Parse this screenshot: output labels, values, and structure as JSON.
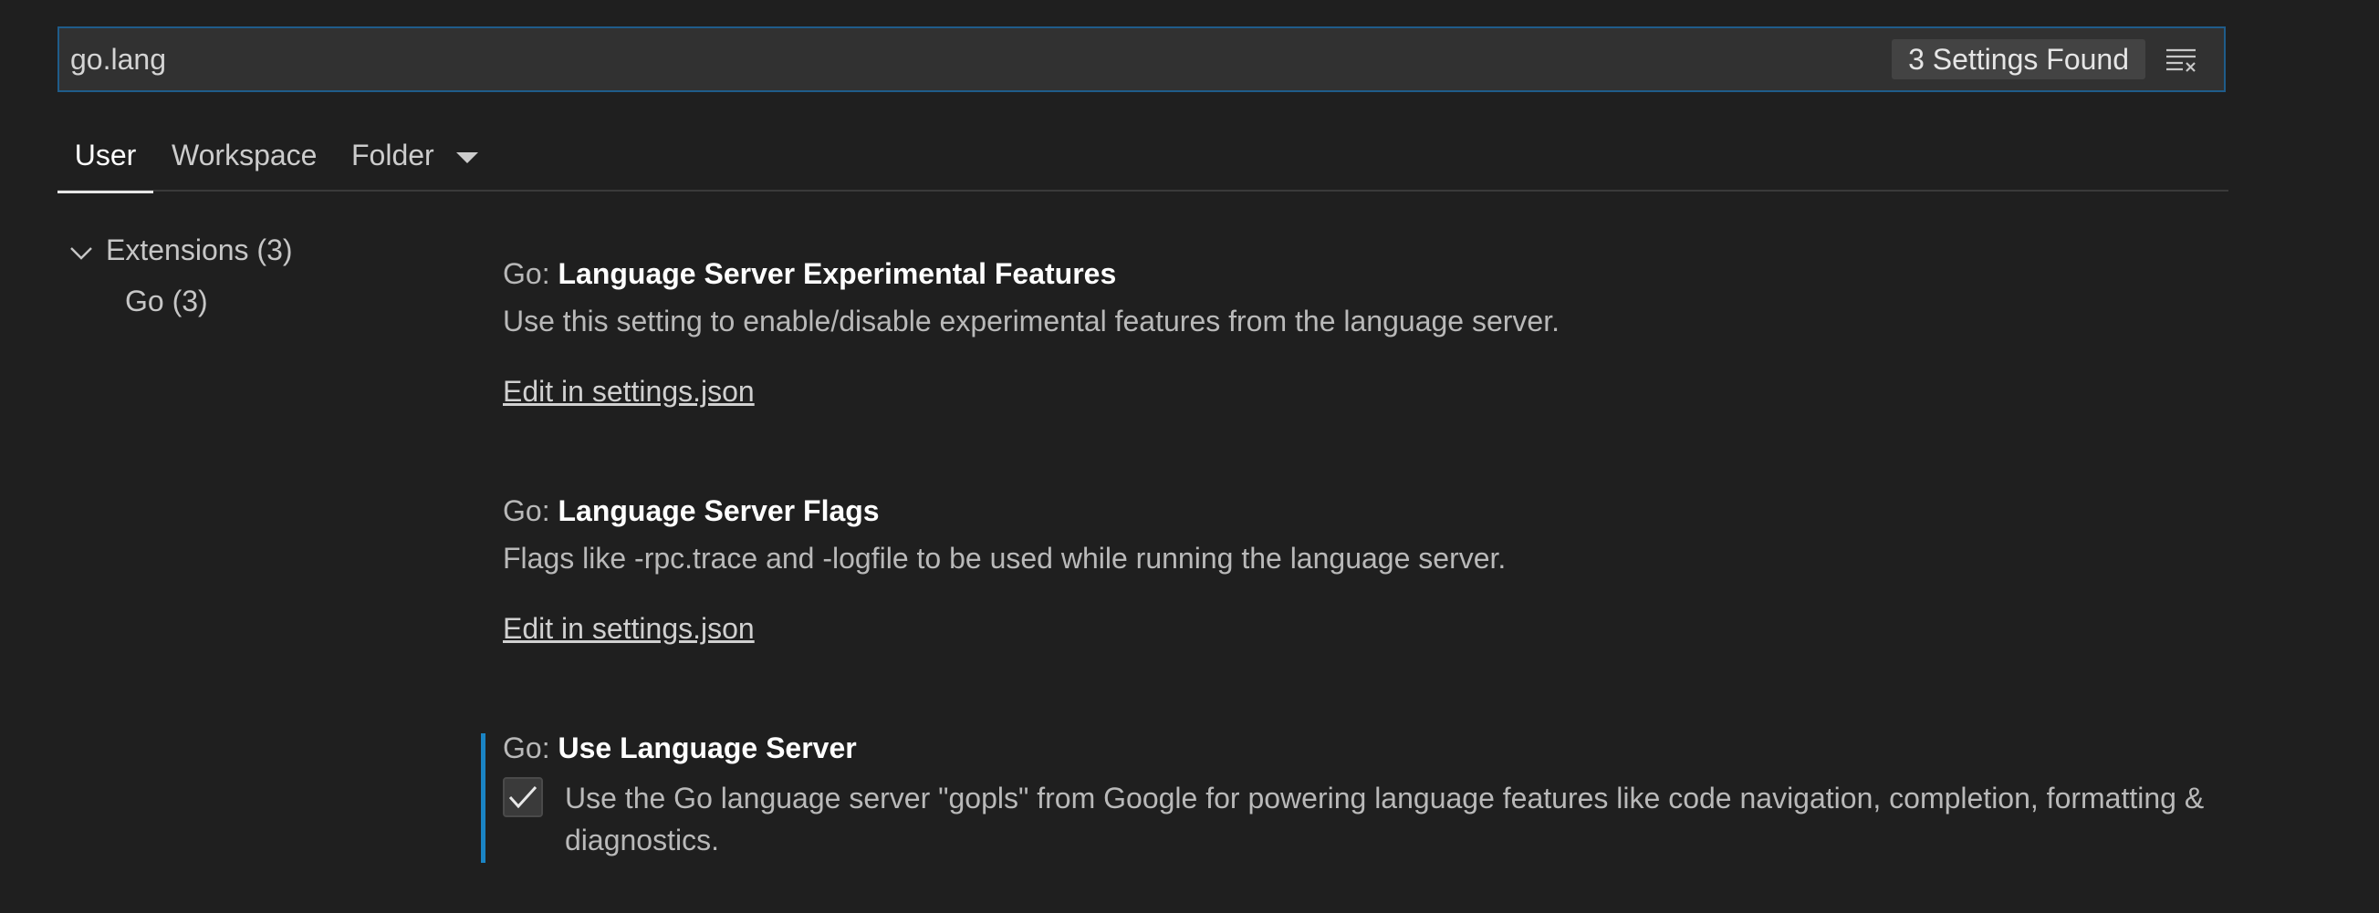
{
  "search": {
    "value": "go.lang",
    "count_label": "3 Settings Found"
  },
  "tabs": [
    {
      "label": "User",
      "active": true
    },
    {
      "label": "Workspace",
      "active": false
    },
    {
      "label": "Folder",
      "active": false
    }
  ],
  "toc": {
    "group_label": "Extensions (3)",
    "child_label": "Go (3)"
  },
  "settings": [
    {
      "category": "Go: ",
      "name": "Language Server Experimental Features",
      "description": "Use this setting to enable/disable experimental features from the language server.",
      "link": "Edit in settings.json"
    },
    {
      "category": "Go: ",
      "name": "Language Server Flags",
      "description": "Flags like -rpc.trace and -logfile to be used while running the language server.",
      "link": "Edit in settings.json"
    },
    {
      "category": "Go: ",
      "name": "Use Language Server",
      "checked": true,
      "description": "Use the Go language server \"gopls\" from Google for powering language features like code navigation, completion, formatting & diagnostics."
    }
  ],
  "icons": {
    "clear": "clear-filter-icon",
    "folder_dropdown": "caret-down-icon",
    "toc_expand": "chevron-down-icon",
    "checkbox": "check-icon"
  },
  "colors": {
    "background": "#1f1f1f",
    "search_border": "#1f5c8a",
    "focus_bar": "#1a84c4"
  }
}
